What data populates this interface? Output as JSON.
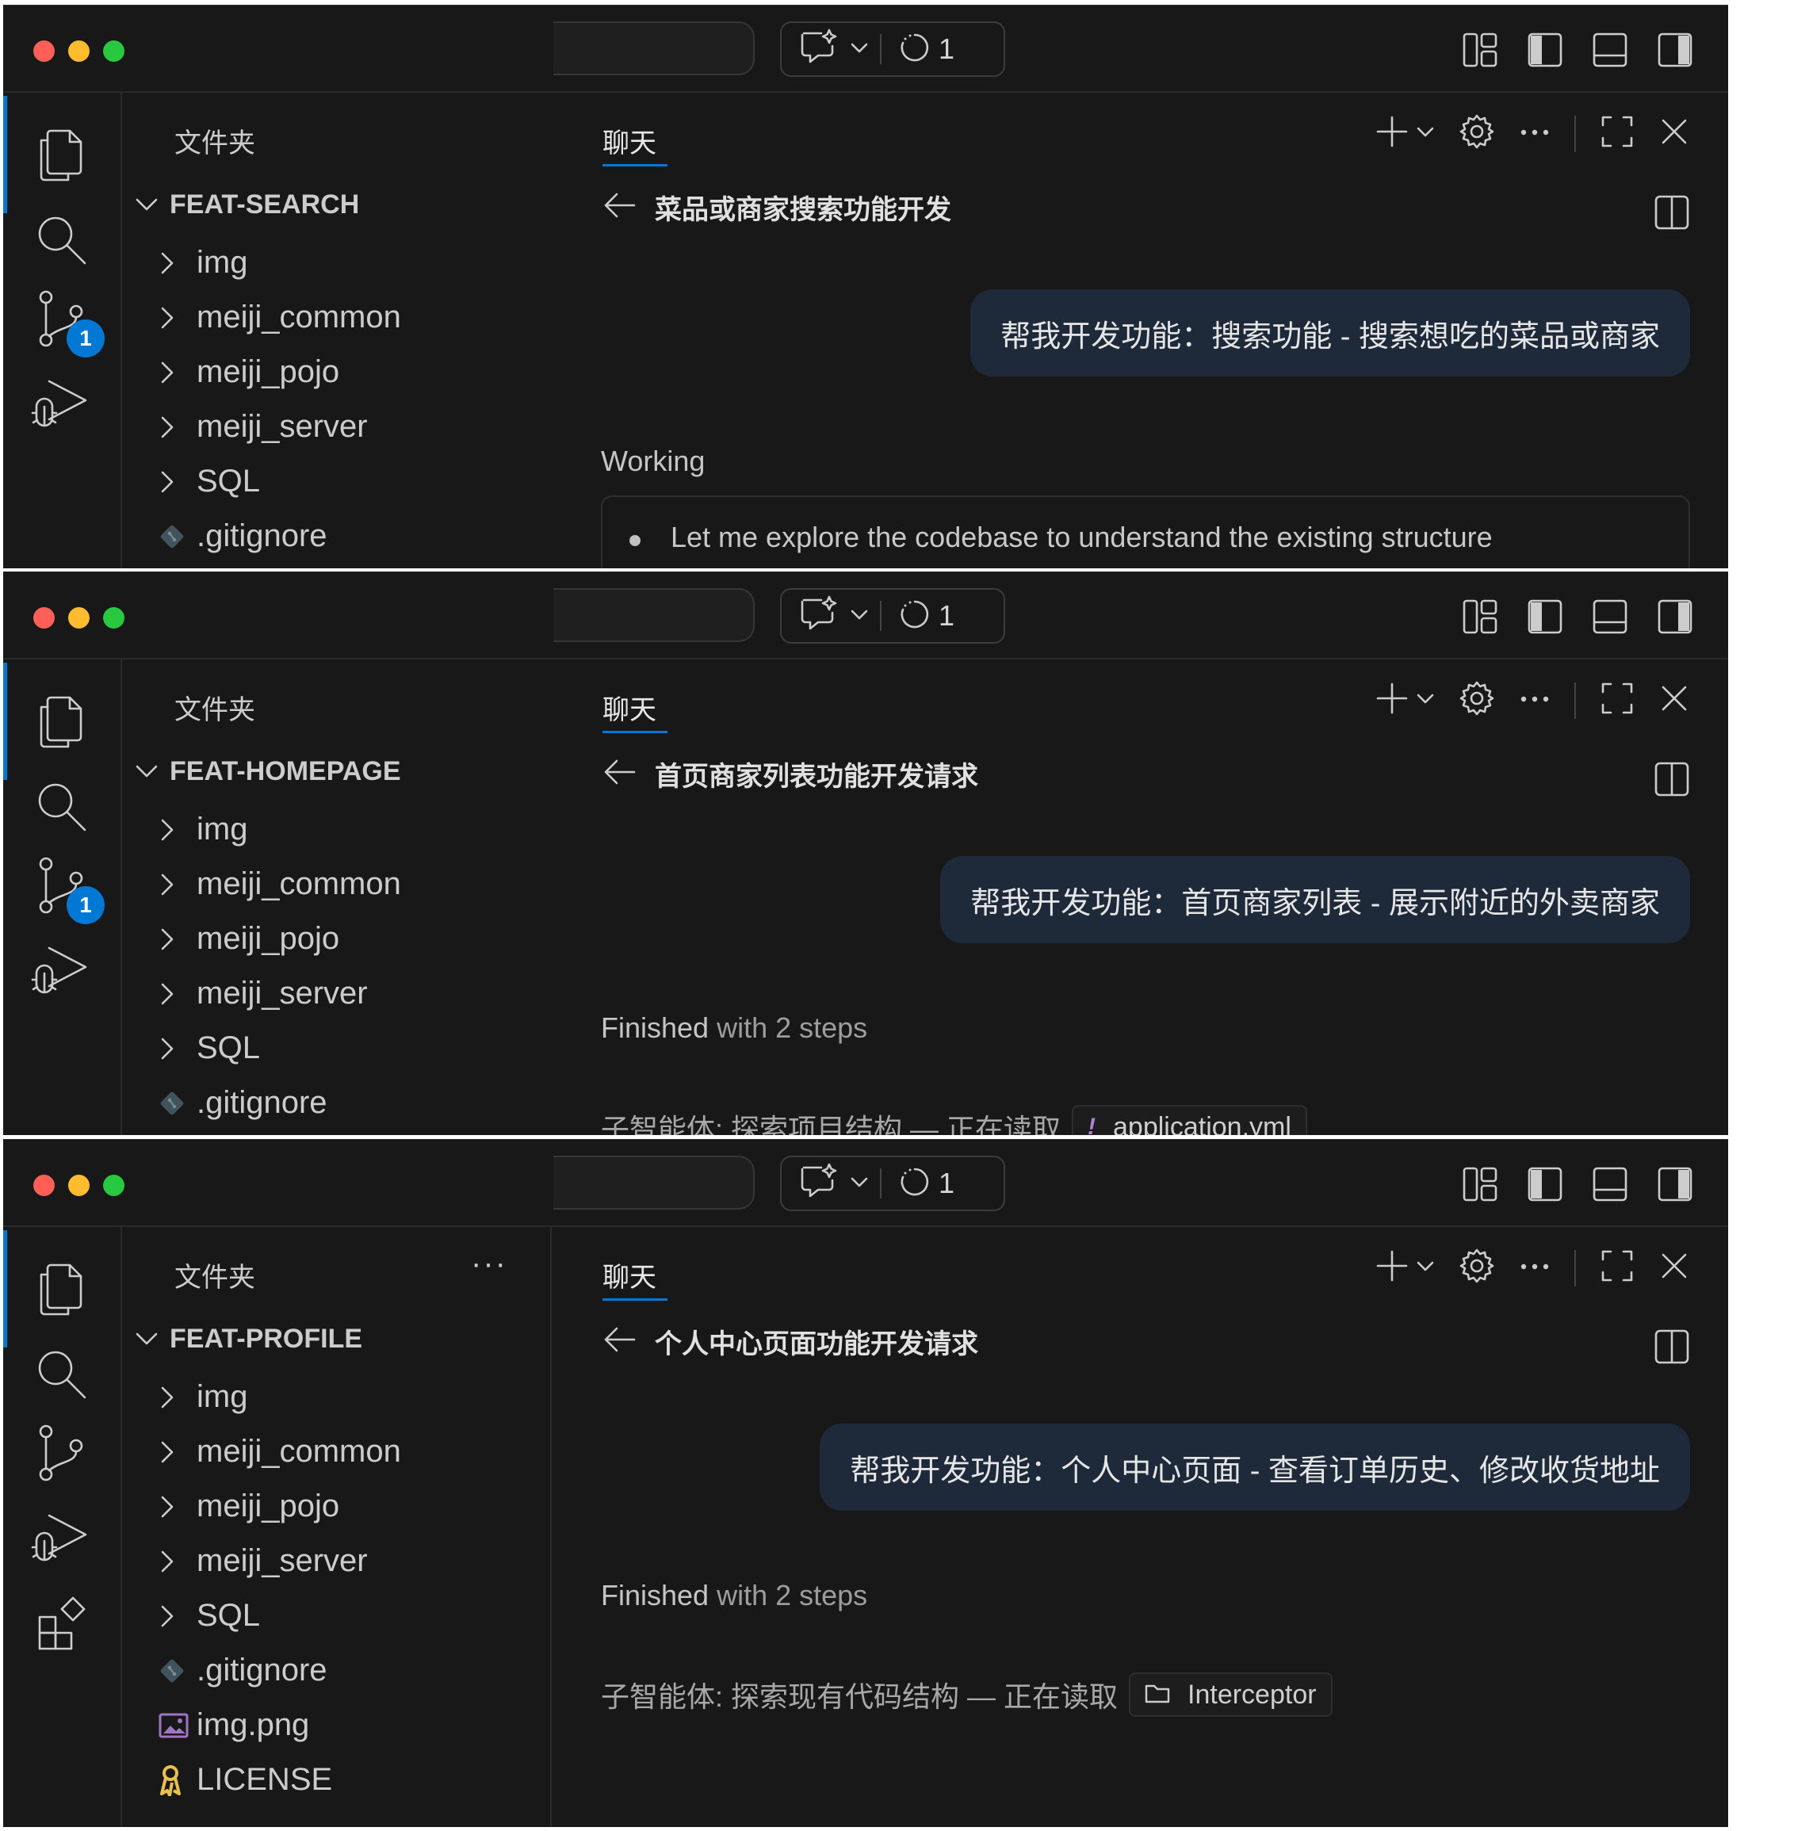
{
  "windows": [
    {
      "title_bar": {
        "agent_count": "1"
      },
      "activity": {
        "scm_badge": "1"
      },
      "explorer": {
        "title": "文件夹",
        "show_more": false,
        "root": "FEAT-SEARCH",
        "items": [
          {
            "label": "img",
            "kind": "folder"
          },
          {
            "label": "meiji_common",
            "kind": "folder"
          },
          {
            "label": "meiji_pojo",
            "kind": "folder"
          },
          {
            "label": "meiji_server",
            "kind": "folder"
          },
          {
            "label": "SQL",
            "kind": "folder"
          },
          {
            "label": ".gitignore",
            "kind": "git"
          }
        ]
      },
      "chat": {
        "tab": "聊天",
        "conversation_title": "菜品或商家搜索功能开发",
        "user_message": "帮我开发功能：搜索功能 - 搜索想吃的菜品或商家",
        "status_strong": "Working",
        "status_rest": "",
        "work_item": "Let me explore the codebase to understand the existing structure"
      }
    },
    {
      "title_bar": {
        "agent_count": "1"
      },
      "activity": {
        "scm_badge": "1"
      },
      "explorer": {
        "title": "文件夹",
        "show_more": false,
        "root": "FEAT-HOMEPAGE",
        "items": [
          {
            "label": "img",
            "kind": "folder"
          },
          {
            "label": "meiji_common",
            "kind": "folder"
          },
          {
            "label": "meiji_pojo",
            "kind": "folder"
          },
          {
            "label": "meiji_server",
            "kind": "folder"
          },
          {
            "label": "SQL",
            "kind": "folder"
          },
          {
            "label": ".gitignore",
            "kind": "git"
          }
        ]
      },
      "chat": {
        "tab": "聊天",
        "conversation_title": "首页商家列表功能开发请求",
        "user_message": "帮我开发功能：首页商家列表 - 展示附近的外卖商家",
        "status_strong": "Finished",
        "status_rest": " with 2 steps",
        "subagent_text": "子智能体: 探索项目结构 — 正在读取",
        "chip_label": "application.yml",
        "chip_kind": "yaml"
      }
    },
    {
      "title_bar": {
        "agent_count": "1"
      },
      "activity": {
        "scm_badge": ""
      },
      "explorer": {
        "title": "文件夹",
        "show_more": true,
        "more_label": "···",
        "root": "FEAT-PROFILE",
        "items": [
          {
            "label": "img",
            "kind": "folder"
          },
          {
            "label": "meiji_common",
            "kind": "folder"
          },
          {
            "label": "meiji_pojo",
            "kind": "folder"
          },
          {
            "label": "meiji_server",
            "kind": "folder"
          },
          {
            "label": "SQL",
            "kind": "folder"
          },
          {
            "label": ".gitignore",
            "kind": "git"
          },
          {
            "label": "img.png",
            "kind": "image"
          },
          {
            "label": "LICENSE",
            "kind": "license"
          }
        ]
      },
      "chat": {
        "tab": "聊天",
        "conversation_title": "个人中心页面功能开发请求",
        "user_message": "帮我开发功能：个人中心页面 - 查看订单历史、修改收货地址",
        "status_strong": "Finished",
        "status_rest": " with 2 steps",
        "subagent_text": "子智能体: 探索现有代码结构 — 正在读取",
        "chip_label": "Interceptor",
        "chip_kind": "folder"
      }
    }
  ],
  "colors": {
    "accent": "#0078d4",
    "bubble": "#1e2a3a",
    "background": "#181818",
    "traffic_red": "#ff5f57",
    "traffic_yellow": "#febc2e",
    "traffic_green": "#28c840"
  },
  "icons": [
    "explorer-icon",
    "search-icon",
    "source-control-icon",
    "run-debug-icon",
    "extensions-icon",
    "copilot-chat-icon",
    "agent-progress-icon",
    "add-icon",
    "settings-gear-icon",
    "more-icon",
    "maximize-icon",
    "close-icon",
    "back-arrow-icon",
    "split-editor-icon",
    "chevron-right-icon",
    "chevron-down-icon"
  ]
}
